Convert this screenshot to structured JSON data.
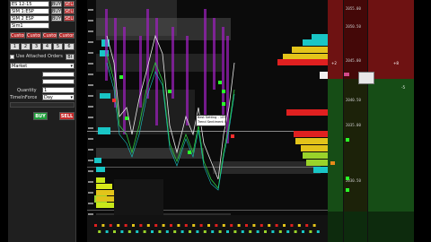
{
  "order_panel": {
    "instrument_rows": [
      {
        "label": "ES 12-15",
        "value": "",
        "buy": "BUY",
        "sell": "SELL"
      },
      {
        "label": "SIM 1:ESP",
        "value": "",
        "buy": "BUY",
        "sell": "SELL"
      },
      {
        "label": "SIM 2 ESP",
        "value": "",
        "buy": "BUY",
        "sell": "SELL"
      },
      {
        "label": "Sim1",
        "value": "",
        "buy": "",
        "sell": ""
      }
    ],
    "action_buttons": [
      "Custom",
      "Custom",
      "Custom",
      "Custom"
    ],
    "quantity_presets": [
      "1",
      "2",
      "3",
      "4",
      "5",
      "6"
    ],
    "attached_orders_label": "Use Attached Orders",
    "attached_orders_btn": "Bt",
    "order_type": "Market",
    "quantity_label": "Quantity",
    "quantity_value": "1",
    "tif_label": "TimeInForce",
    "tif_value": "Day",
    "buy_button": "BUY",
    "sell_button": "SELL"
  },
  "chart": {
    "annotation_line1": "Best Setting - 10%",
    "annotation_line2": "Trend Sentiment Indicator"
  },
  "ladder": {
    "prices_top": [
      "2055.00",
      "2050.50",
      "2045.00"
    ],
    "prices_bottom": [
      "2040.50",
      "2035.00",
      "2030.50"
    ],
    "labels": [
      "+8",
      "-5",
      "+2"
    ]
  },
  "colors": {
    "bid": "#1a5c1a",
    "ask": "#7a1313",
    "accent": "#00c8c8",
    "vol": "#d94040"
  }
}
